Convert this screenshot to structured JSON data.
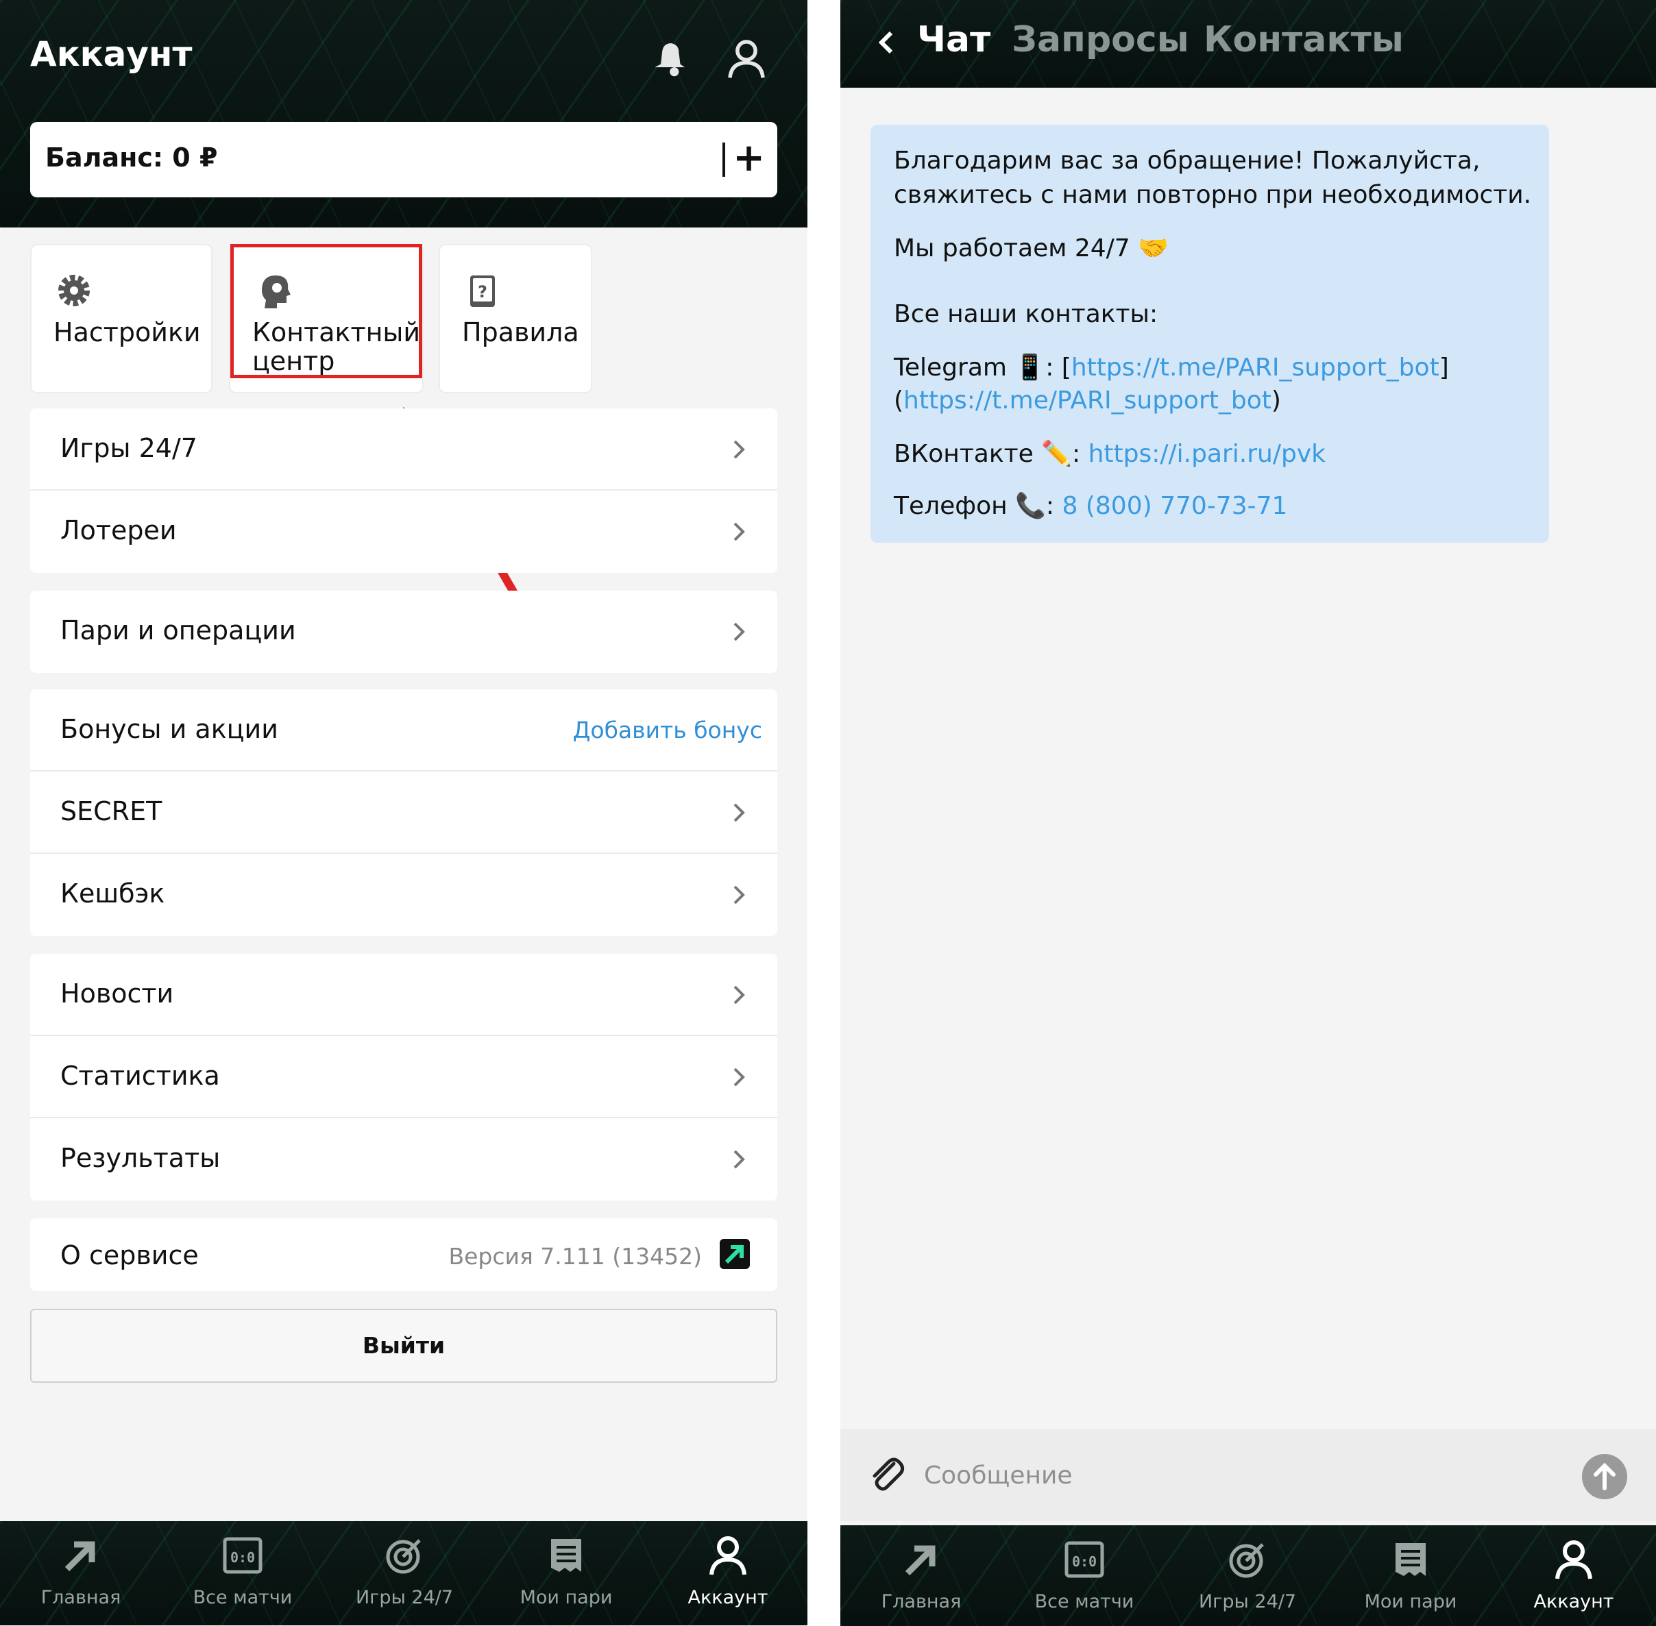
{
  "left": {
    "header": {
      "title": "Аккаунт",
      "balance_label": "Баланс: 0 ₽",
      "add_label": "+"
    },
    "tiles": [
      {
        "label": "Настройки"
      },
      {
        "label": "Контактный центр"
      },
      {
        "label": "Правила"
      }
    ],
    "groups": {
      "g1": [
        "Игры 24/7",
        "Лотереи"
      ],
      "g2": [
        "Пари и операции"
      ],
      "g3_first": {
        "label": "Бонусы и акции",
        "link": "Добавить бонус"
      },
      "g3_rest": [
        "SECRET",
        "Кешбэк"
      ],
      "g4": [
        "Новости",
        "Статистика",
        "Результаты"
      ],
      "about": {
        "label": "О сервисе",
        "version": "Версия 7.111 (13452)"
      }
    },
    "logout_label": "Выйти"
  },
  "tabbar": {
    "items": [
      {
        "label": "Главная",
        "icon": "arrow-icon"
      },
      {
        "label": "Все матчи",
        "icon": "scoreboard-icon"
      },
      {
        "label": "Игры 24/7",
        "icon": "target-icon"
      },
      {
        "label": "Мои пари",
        "icon": "receipt-icon"
      },
      {
        "label": "Аккаунт",
        "icon": "user-icon",
        "active": true
      }
    ]
  },
  "right": {
    "header": {
      "tabs": [
        "Чат",
        "Запросы",
        "Контакты"
      ]
    },
    "message": {
      "line1": "Благодарим вас за обращение! Пожалуйста,",
      "line2": "свяжитесь с нами повторно при необходимости.",
      "hours": "Мы работаем 24/7",
      "hours_emoji": "🤝",
      "contacts_title": "Все наши контакты:",
      "tg_label": "Telegram",
      "tg_emoji": "📱",
      "tg_link": "https://t.me/PARI_support_bot",
      "vk_label": "ВКонтакте",
      "vk_emoji": "✏️",
      "vk_link": "https://i.pari.ru/pvk",
      "phone_label": "Телефон",
      "phone_emoji": "📞",
      "phone_link": "8 (800) 770-73-71"
    },
    "input": {
      "placeholder": "Сообщение"
    }
  },
  "colors": {
    "accent_link": "#3b9ae0",
    "highlight": "#e02424",
    "bubble": "#d4e7f8",
    "active_tab": "#ffffff"
  }
}
